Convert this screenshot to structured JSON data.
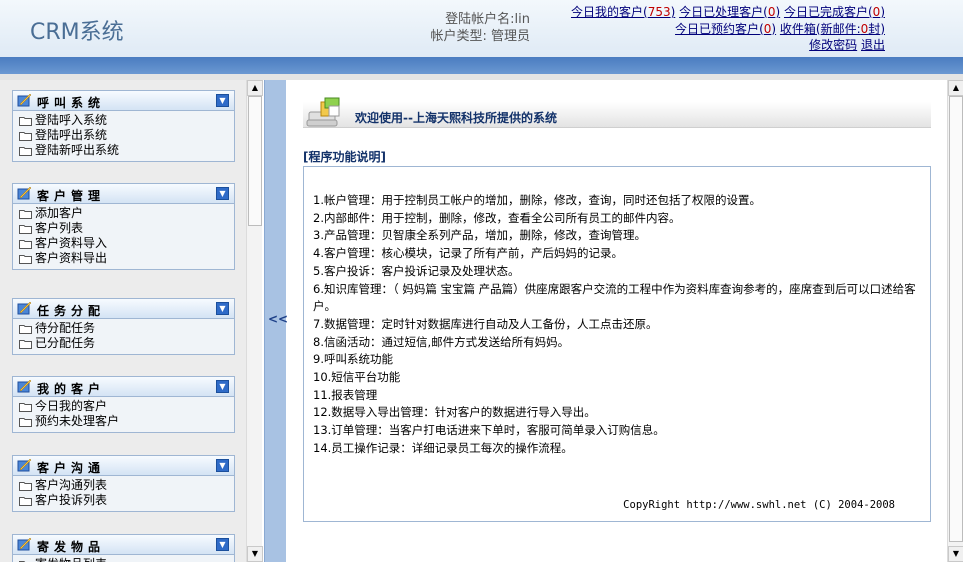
{
  "header": {
    "logo": "CRM系统",
    "account_label": "登陆帐户名:lin",
    "type_label": "帐户类型: 管理员",
    "stats": {
      "today_my": {
        "label": "今日我的客户",
        "count": "753"
      },
      "today_processed": {
        "label": "今日已处理客户",
        "count": "0"
      },
      "today_done": {
        "label": "今日已完成客户",
        "count": "0"
      },
      "today_reserved": {
        "label": "今日已预约客户",
        "count": "0"
      },
      "inbox": {
        "label": "收件箱",
        "new_label": "新邮件:",
        "count": "0",
        "unit": "封"
      },
      "change_password": "修改密码",
      "logout": "退出"
    }
  },
  "sidebar": {
    "groups": [
      {
        "title": "呼叫系统",
        "items": [
          "登陆呼入系统",
          "登陆呼出系统",
          "登陆新呼出系统"
        ]
      },
      {
        "title": "客户管理",
        "items": [
          "添加客户",
          "客户列表",
          "客户资料导入",
          "客户资料导出"
        ]
      },
      {
        "title": "任务分配",
        "items": [
          "待分配任务",
          "已分配任务"
        ]
      },
      {
        "title": "我的客户",
        "items": [
          "今日我的客户",
          "预约未处理客户"
        ]
      },
      {
        "title": "客户沟通",
        "items": [
          "客户沟通列表",
          "客户投诉列表"
        ]
      },
      {
        "title": "寄发物品",
        "items": [
          "寄发物品列表"
        ]
      }
    ],
    "collapse_symbol": "▼"
  },
  "splitter": {
    "arrow": "<<"
  },
  "main": {
    "welcome": "欢迎使用--上海天熙科技所提供的系统",
    "section_title": "[程序功能说明]",
    "features": [
      "1.帐户管理：用于控制员工帐户的增加，删除，修改，查询，同时还包括了权限的设置。",
      "2.内部邮件：用于控制，删除，修改，查看全公司所有员工的邮件内容。",
      "3.产品管理：贝智康全系列产品，增加，删除，修改，查询管理。",
      "4.客户管理：核心模块，记录了所有产前，产后妈妈的记录。",
      "5.客户投诉：客户投诉记录及处理状态。",
      "6.知识库管理：（ 妈妈篇 宝宝篇 产品篇）供座席跟客户交流的工程中作为资料库查询参考的，座席查到后可以口述给客户。",
      "7.数据管理：定时针对数据库进行自动及人工备份，人工点击还原。",
      "8.信函活动：通过短信,邮件方式发送给所有妈妈。",
      "9.呼叫系统功能",
      "10.短信平台功能",
      "11.报表管理",
      "12.数据导入导出管理：针对客户的数据进行导入导出。",
      "13.订单管理：当客户打电话进来下单时，客服可简单录入订购信息。",
      "14.员工操作记录：详细记录员工每次的操作流程。"
    ],
    "copyright": "CopyRight http://www.swhl.net (C) 2004-2008"
  },
  "scrollbars": {
    "up": "▲",
    "down": "▼"
  }
}
